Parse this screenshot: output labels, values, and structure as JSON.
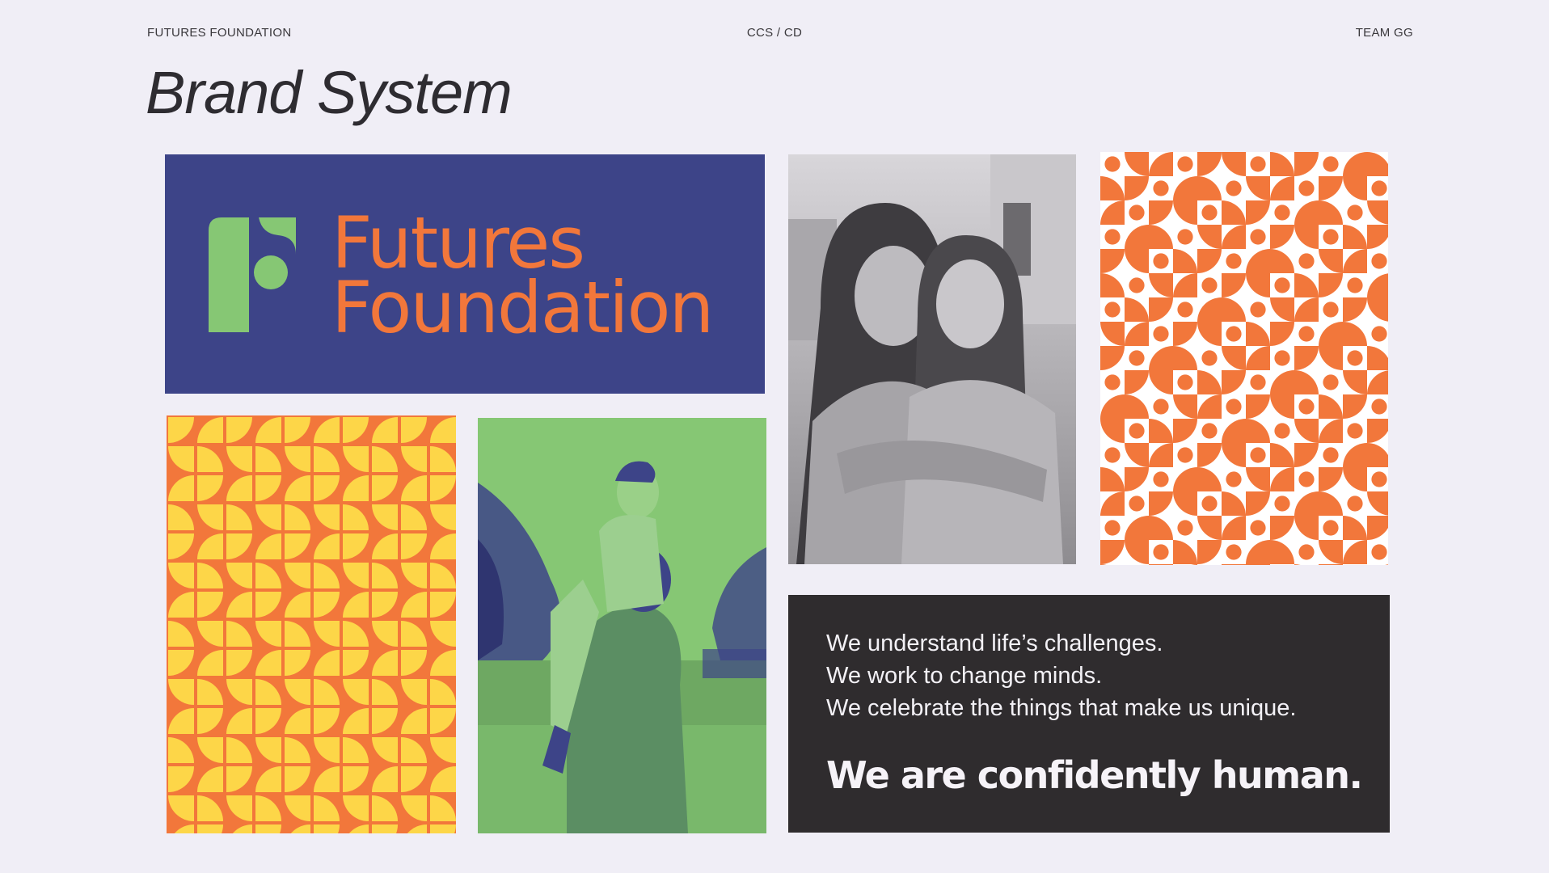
{
  "header": {
    "left": "FUTURES FOUNDATION",
    "center": "CCS / CD",
    "right": "TEAM GG"
  },
  "title": "Brand System",
  "logo": {
    "line1": "Futures",
    "line2": "Foundation",
    "mark_icon": "futures-f-mark-icon"
  },
  "tagline": {
    "lines": [
      "We understand life’s challenges.",
      "We work to change minds.",
      "We celebrate the things that make us unique."
    ],
    "main": "We are confidently human."
  },
  "colors": {
    "background": "#f0eef6",
    "navy": "#3d4488",
    "orange": "#f2773b",
    "green": "#86c774",
    "yellow": "#fdd648",
    "dark": "#2f2c2e"
  }
}
